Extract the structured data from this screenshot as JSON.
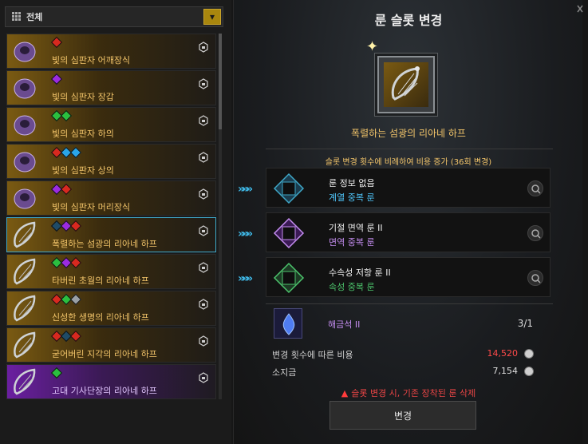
{
  "filter": {
    "label": "전체",
    "dropdown_icon": "chevron-down-icon"
  },
  "items": [
    {
      "name": "빛의 심판자 어깨장식",
      "gems": [
        "red"
      ],
      "style": "gold"
    },
    {
      "name": "빛의 심판자 장갑",
      "gems": [
        "purple"
      ],
      "style": "gold"
    },
    {
      "name": "빛의 심판자 하의",
      "gems": [
        "green",
        "green"
      ],
      "style": "gold"
    },
    {
      "name": "빛의 심판자 상의",
      "gems": [
        "red",
        "blue",
        "blue"
      ],
      "style": "gold"
    },
    {
      "name": "빛의 심판자 머리장식",
      "gems": [
        "purple",
        "red"
      ],
      "style": "gold"
    },
    {
      "name": "폭렬하는 섬광의 리아네 하프",
      "gems": [
        "dark",
        "purple",
        "red"
      ],
      "style": "gold",
      "selected": true
    },
    {
      "name": "타버린 초월의 리아네 하프",
      "gems": [
        "green",
        "purple",
        "red"
      ],
      "style": "gold"
    },
    {
      "name": "신성한 생명의 리아네 하프",
      "gems": [
        "red",
        "green",
        "grey"
      ],
      "style": "gold"
    },
    {
      "name": "굳어버린 지각의 리아네 하프",
      "gems": [
        "red",
        "dark",
        "red"
      ],
      "style": "gold"
    },
    {
      "name": "고대 기사단장의 리아네 하프",
      "gems": [
        "green"
      ],
      "style": "purple"
    }
  ],
  "panel": {
    "title": "룬 슬롯 변경",
    "selected_item": "폭렬하는 섬광의 리아네 하프",
    "cost_note": "슬롯 변경 횟수에 비례하여 비용 증가 (36회 변경)",
    "runes": [
      {
        "name": "룬 정보 없음",
        "type": "계열 중복 룬",
        "type_color": "#4fc3f7"
      },
      {
        "name": "기절 면역 룬 II",
        "type": "면역 중복 룬",
        "type_color": "#c48df0"
      },
      {
        "name": "수속성 저항 룬 II",
        "type": "속성 중복 룬",
        "type_color": "#4cc46c"
      }
    ],
    "unlock_item": "해금석 II",
    "unlock_count": "3/1",
    "cost_label": "변경 횟수에 따른 비용",
    "cost_value": "14,520",
    "gold_label": "소지금",
    "gold_value": "7,154",
    "warning": "슬롯 변경 시, 기존 장착된 룬 삭제",
    "change_button": "변경"
  },
  "colors": {
    "accent_blue": "#3fb9e8",
    "gold_text": "#f3c56a",
    "warning_red": "#e84545",
    "cost_red": "#ff4a4a"
  }
}
